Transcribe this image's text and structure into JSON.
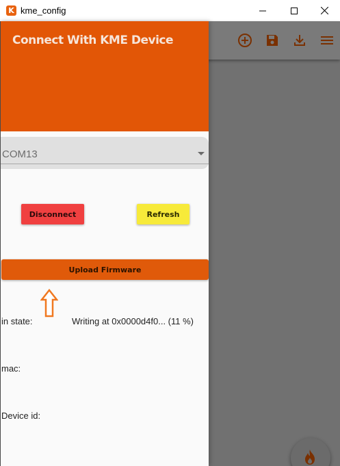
{
  "window": {
    "title": "kme_config",
    "icon_letter": "K",
    "buttons": [
      "minimize",
      "maximize",
      "close"
    ]
  },
  "appbar": {
    "icons": [
      "add-circle-icon",
      "save-icon",
      "download-icon",
      "menu-icon"
    ],
    "icon_color": "#7a3000"
  },
  "drawer": {
    "title": "Connect With KME Device",
    "header_color": "#e25606",
    "port": {
      "selected": "COM13"
    },
    "buttons": {
      "disconnect": "Disconnect",
      "refresh": "Refresh",
      "upload": "Upload Firmware"
    },
    "colors": {
      "disconnect": "#f04040",
      "refresh": "#f7ea3a",
      "upload": "#e05a0a"
    },
    "info": {
      "state_label": "in state:",
      "state_value": "Writing at 0x0000d4f0... (11 %)",
      "mac_label": "mac:",
      "mac_value": "",
      "device_id_label": "Device id:",
      "device_id_value": ""
    }
  },
  "fab": {
    "icon": "fire-icon"
  }
}
